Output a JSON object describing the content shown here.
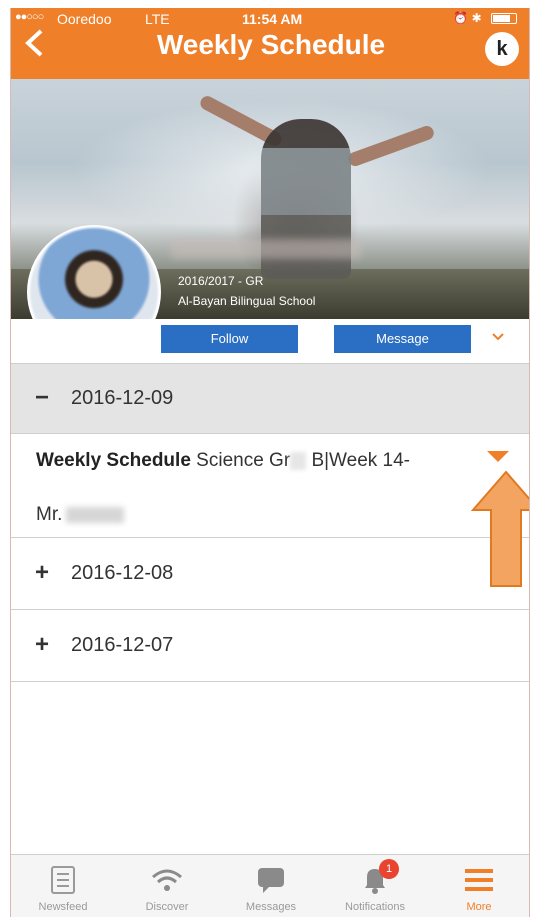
{
  "status_bar": {
    "carrier": "Ooredoo",
    "network": "LTE",
    "time": "11:54 AM"
  },
  "header": {
    "back_icon": "chevron-left-icon",
    "title": "Weekly Schedule",
    "logo_letter": "k"
  },
  "profile": {
    "year": "2016/2017 - GR",
    "school": "Al-Bayan Bilingual School",
    "follow_label": "Follow",
    "message_label": "Message",
    "more_icon": "chevron-down-icon"
  },
  "schedule": {
    "expanded": {
      "symbol": "−",
      "date": "2016-12-09",
      "entry_bold": "Weekly Schedule",
      "entry_subject_a": "Science Gr",
      "entry_subject_b": "B|Week 14-",
      "entry_teacher": "Mr."
    },
    "collapsed": [
      {
        "symbol": "+",
        "date": "2016-12-08"
      },
      {
        "symbol": "+",
        "date": "2016-12-07"
      }
    ]
  },
  "tabs": [
    {
      "label": "Newsfeed",
      "icon": "newsfeed-icon"
    },
    {
      "label": "Discover",
      "icon": "wifi-icon"
    },
    {
      "label": "Messages",
      "icon": "chat-bubble-icon"
    },
    {
      "label": "Notifications",
      "icon": "bell-icon",
      "badge": "1"
    },
    {
      "label": "More",
      "icon": "menu-icon"
    }
  ],
  "colors": {
    "accent": "#f07f2a",
    "button_blue": "#2a6fc4",
    "badge_red": "#e8442f"
  }
}
